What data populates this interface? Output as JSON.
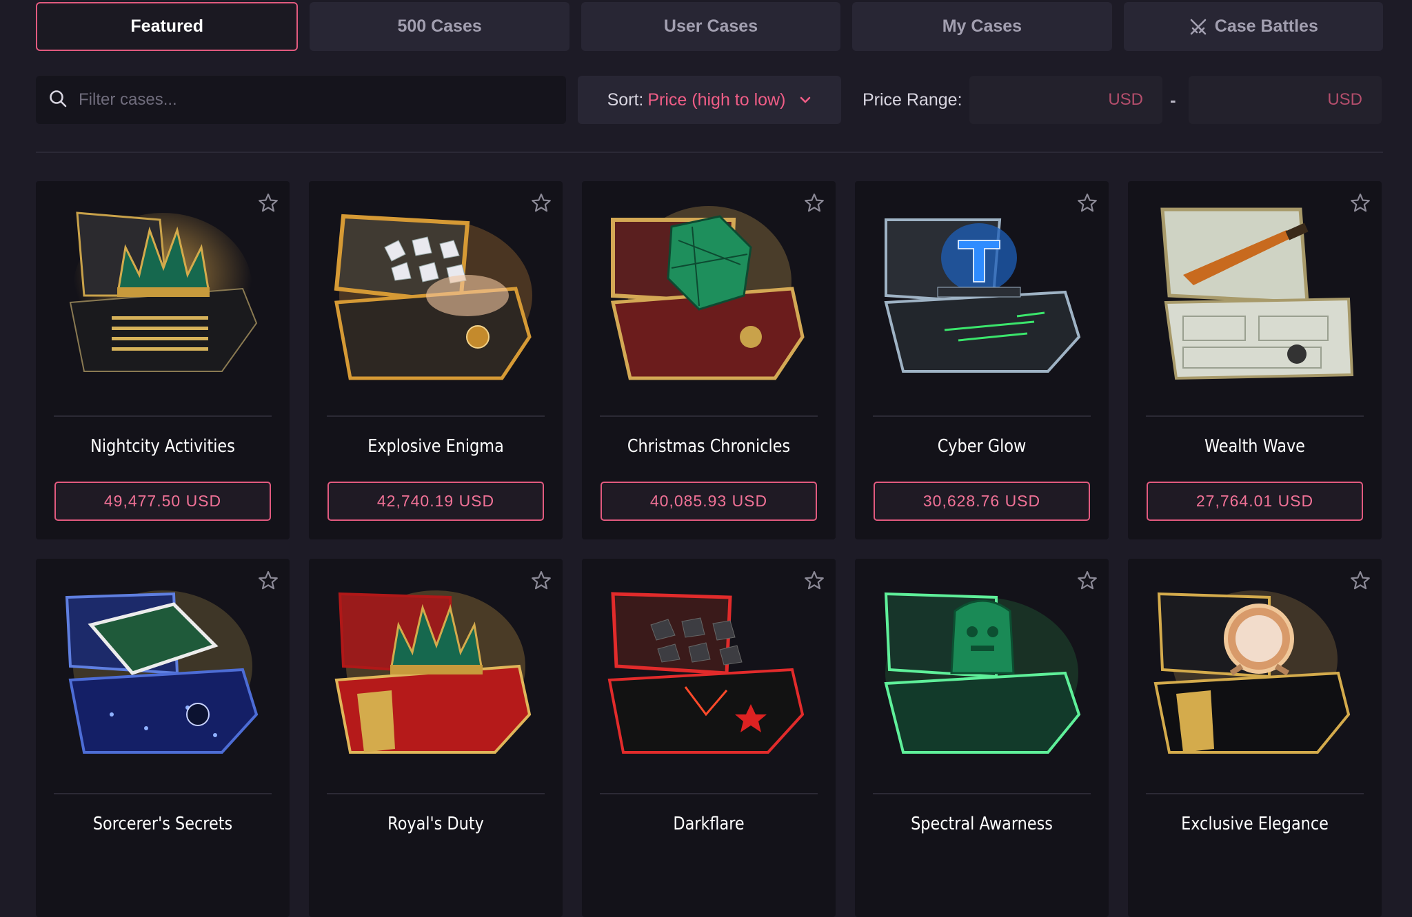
{
  "tabs": [
    {
      "label": "Featured",
      "active": true
    },
    {
      "label": "500 Cases",
      "active": false
    },
    {
      "label": "User Cases",
      "active": false
    },
    {
      "label": "My Cases",
      "active": false
    },
    {
      "label": "Case Battles",
      "active": false,
      "icon": "crossed-swords-icon"
    }
  ],
  "filters": {
    "search_placeholder": "Filter cases...",
    "sort_prefix": "Sort:",
    "sort_value": "Price (high to low)",
    "price_range_label": "Price Range:",
    "range_min_suffix": "USD",
    "range_separator": "-",
    "range_max_suffix": "USD"
  },
  "colors": {
    "accent": "#e25a7f",
    "background": "#1d1b26",
    "card": "#131219"
  },
  "cases": [
    {
      "name": "Nightcity Activities",
      "price": "49,477.50 USD",
      "icon": "black-gold-crate-emerald-crown"
    },
    {
      "name": "Explosive Enigma",
      "price": "42,740.19 USD",
      "icon": "gold-crate-diamonds"
    },
    {
      "name": "Christmas Chronicles",
      "price": "40,085.93 USD",
      "icon": "red-gold-crate-emerald-cube"
    },
    {
      "name": "Cyber Glow",
      "price": "30,628.76 USD",
      "icon": "neon-crate-katowice-logo"
    },
    {
      "name": "Wealth Wave",
      "price": "27,764.01 USD",
      "icon": "money-crate-awp-rifle"
    },
    {
      "name": "Sorcerer's Secrets",
      "price": "",
      "icon": "blue-crate-spellbook"
    },
    {
      "name": "Royal's Duty",
      "price": "",
      "icon": "red-gold-crate-emerald-crown"
    },
    {
      "name": "Darkflare",
      "price": "",
      "icon": "red-black-crate-coal"
    },
    {
      "name": "Spectral Awarness",
      "price": "",
      "icon": "green-crate-jade-idol"
    },
    {
      "name": "Exclusive Elegance",
      "price": "",
      "icon": "black-gold-crate-watch"
    }
  ]
}
